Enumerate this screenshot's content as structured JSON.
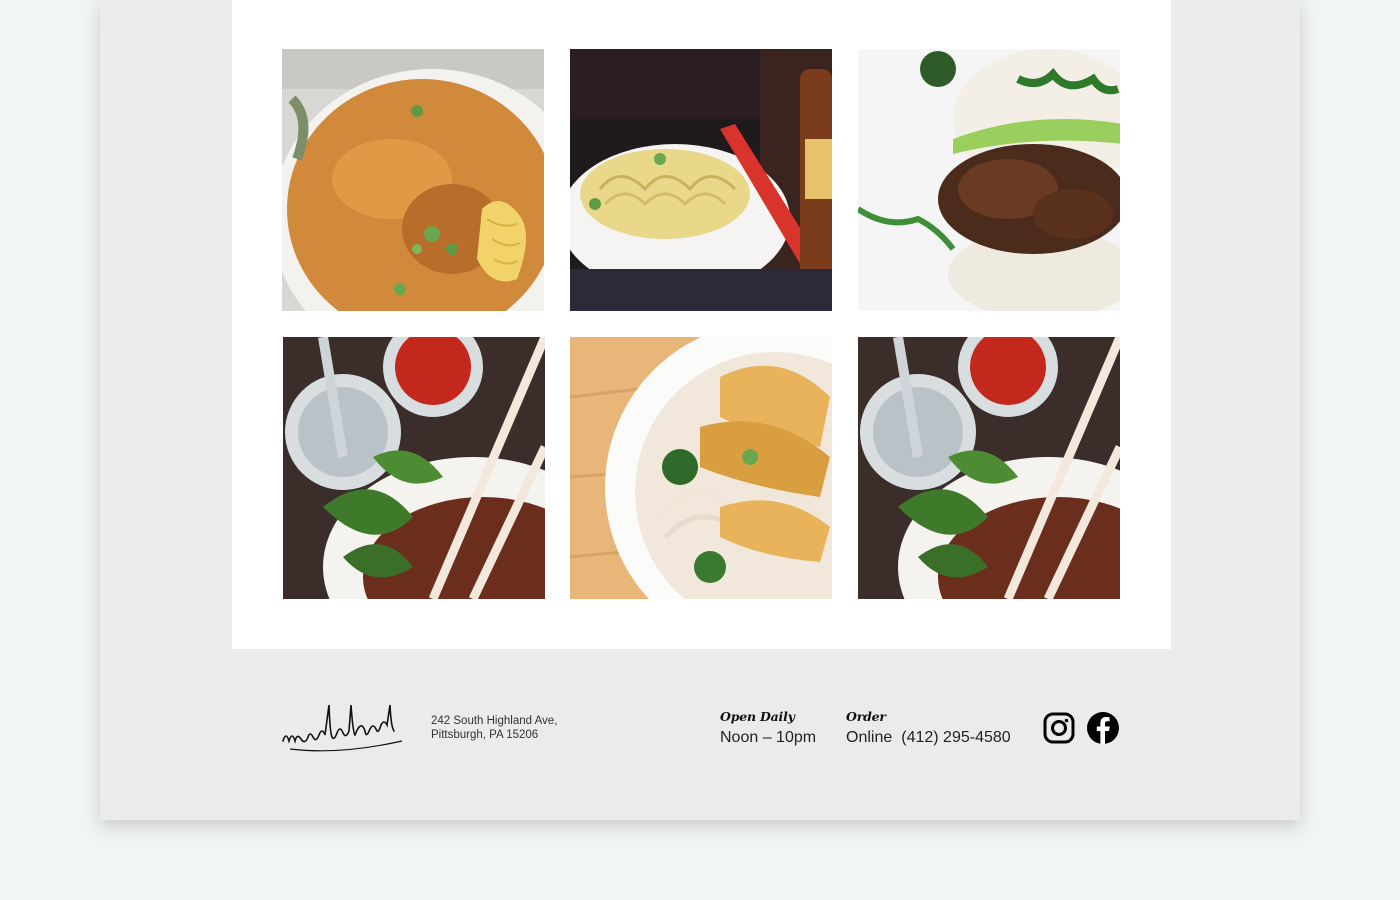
{
  "gallery": {
    "photos": [
      {
        "name": "curry-noodle-bowl"
      },
      {
        "name": "egg-noodle-bowl-with-chopsticks"
      },
      {
        "name": "pork-bun"
      },
      {
        "name": "basil-noodle-soup"
      },
      {
        "name": "crispy-tofu-noodles"
      },
      {
        "name": "basil-noodle-soup"
      }
    ]
  },
  "footer": {
    "logo_text": "noodlehead",
    "address_line1": "242 South Highland Ave,",
    "address_line2": "Pittsburgh, PA 15206",
    "hours_heading": "Open Daily",
    "hours_value": "Noon – 10pm",
    "order_heading": "Order",
    "order_online": "Online",
    "order_phone": "(412) 295-4580",
    "social": [
      "instagram-icon",
      "facebook-icon"
    ]
  },
  "colors": {
    "page_bg": "#f2f5f6",
    "card_bg": "#ebebeb",
    "panel_bg": "#ffffff"
  }
}
